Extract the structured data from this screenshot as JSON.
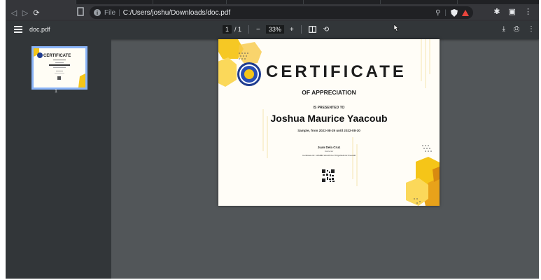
{
  "browser": {
    "file_label": "File",
    "url": "C:/Users/joshu/Downloads/doc.pdf"
  },
  "pdf_toolbar": {
    "doc_name": "doc.pdf",
    "page_current": "1",
    "page_total": "/ 1",
    "zoom_out": "−",
    "zoom": "33%",
    "zoom_in": "+"
  },
  "sidebar": {
    "thumbnail_page": "1"
  },
  "certificate": {
    "title": "CERTIFICATE",
    "subtitle": "OF APPRECIATION",
    "presented_to": "IS PRESENTED TO",
    "recipient": "Joshua Maurice Yaacoub",
    "description": "Sample, from 2022-08-29 until 2022-08-30",
    "signer": "Juan Dela Cruz",
    "signer_role": "Instructor",
    "certificate_id": "Certificate ID: 1RSBBYHKLPlzhm7TPgANHKzGTr/vedd6"
  },
  "colors": {
    "viewer_bg": "#525659",
    "toolbar_bg": "#323639",
    "accent_yellow": "#f5c518",
    "thumb_border": "#8ab4f8",
    "seal_blue": "#1f3c8f"
  }
}
